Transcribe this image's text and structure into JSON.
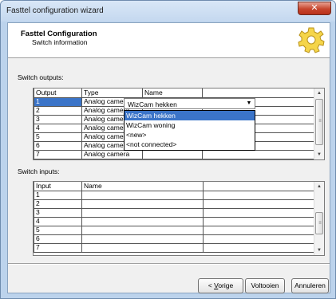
{
  "window": {
    "title": "Fasttel configuration wizard"
  },
  "header": {
    "title": "Fasttel Configuration",
    "subtitle": "Switch information"
  },
  "outputs": {
    "label": "Switch outputs:",
    "columns": [
      "Output",
      "Type",
      "Name"
    ],
    "rows": [
      {
        "output": "1",
        "type": "Analog camera",
        "name": "WizCam hekken"
      },
      {
        "output": "2",
        "type": "Analog camera",
        "name": ""
      },
      {
        "output": "3",
        "type": "Analog camera",
        "name": ""
      },
      {
        "output": "4",
        "type": "Analog camera",
        "name": ""
      },
      {
        "output": "5",
        "type": "Analog camera",
        "name": ""
      },
      {
        "output": "6",
        "type": "Analog camera",
        "name": ""
      },
      {
        "output": "7",
        "type": "Analog camera",
        "name": ""
      }
    ],
    "combo": {
      "value": "WizCam hekken",
      "options": [
        "WizCam hekken",
        "WizCam woning",
        "<new>",
        "<not connected>"
      ],
      "selected_index": 0
    }
  },
  "inputs": {
    "label": "Switch inputs:",
    "columns": [
      "Input",
      "Name"
    ],
    "rows": [
      {
        "input": "1",
        "name": ""
      },
      {
        "input": "2",
        "name": ""
      },
      {
        "input": "3",
        "name": ""
      },
      {
        "input": "4",
        "name": ""
      },
      {
        "input": "5",
        "name": ""
      },
      {
        "input": "6",
        "name": ""
      },
      {
        "input": "7",
        "name": ""
      }
    ]
  },
  "buttons": {
    "back_prefix": "< ",
    "back_mnemonic": "V",
    "back_rest": "orige",
    "finish": "Voltooien",
    "cancel": "Annuleren"
  },
  "icons": {
    "close": "close-icon",
    "gear": "gear-icon",
    "scroll_up": "up-arrow-icon",
    "scroll_down": "down-arrow-icon",
    "dropdown": "chevron-down-icon"
  }
}
